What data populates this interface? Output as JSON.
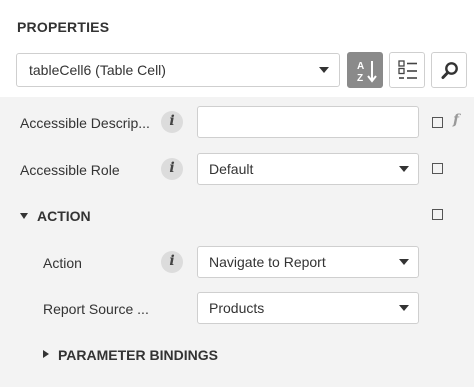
{
  "panel": {
    "title": "PROPERTIES"
  },
  "object_selector": {
    "value": "tableCell6 (Table Cell)"
  },
  "toolbar": {
    "sort_button_icon": "sort-alphabetical-icon",
    "categories_button_icon": "categories-icon",
    "search_button_icon": "search-icon"
  },
  "properties": {
    "accessible_description": {
      "label": "Accessible Descrip...",
      "value": ""
    },
    "accessible_role": {
      "label": "Accessible Role",
      "value": "Default"
    },
    "action_group": {
      "label": "ACTION"
    },
    "action": {
      "label": "Action",
      "value": "Navigate to Report"
    },
    "report_source": {
      "label": "Report Source ...",
      "value": "Products"
    },
    "parameter_bindings": {
      "label": "PARAMETER BINDINGS"
    }
  },
  "colors": {
    "content_background": "#f3f3f3",
    "active_toolbar_button": "#8a8a8a"
  }
}
